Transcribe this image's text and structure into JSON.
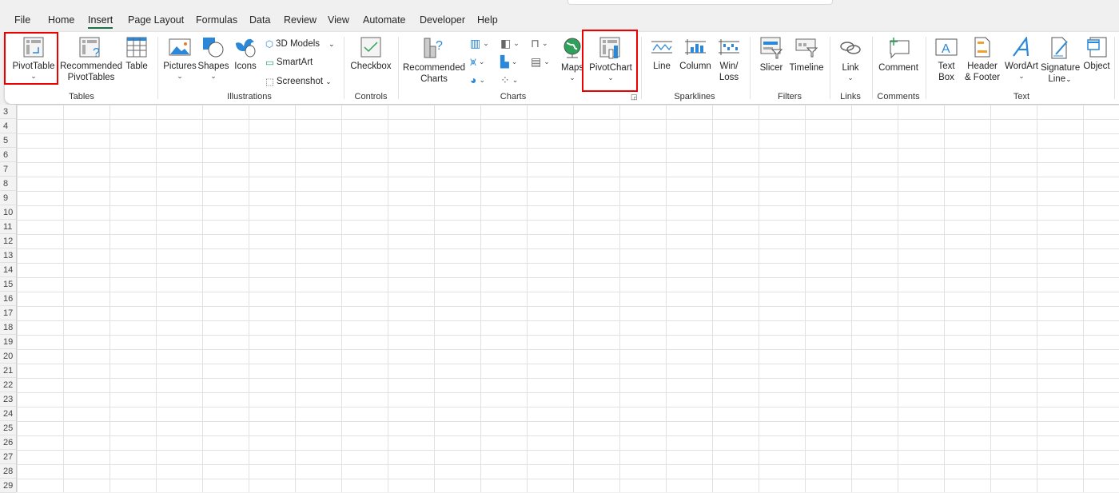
{
  "tabs": [
    "File",
    "Home",
    "Insert",
    "Page Layout",
    "Formulas",
    "Data",
    "Review",
    "View",
    "Automate",
    "Developer",
    "Help"
  ],
  "active_tab": "Insert",
  "groups": {
    "tables": "Tables",
    "illustrations": "Illustrations",
    "controls": "Controls",
    "charts": "Charts",
    "sparklines": "Sparklines",
    "filters": "Filters",
    "links": "Links",
    "comments": "Comments",
    "text": "Text"
  },
  "buttons": {
    "pivottable": "PivotTable",
    "rec_pivot_1": "Recommended",
    "rec_pivot_2": "PivotTables",
    "table": "Table",
    "pictures": "Pictures",
    "shapes": "Shapes",
    "icons": "Icons",
    "models3d": "3D Models",
    "smartart": "SmartArt",
    "screenshot": "Screenshot",
    "checkbox": "Checkbox",
    "rec_charts_1": "Recommended",
    "rec_charts_2": "Charts",
    "maps": "Maps",
    "pivotchart": "PivotChart",
    "line": "Line",
    "column": "Column",
    "winloss_1": "Win/",
    "winloss_2": "Loss",
    "slicer": "Slicer",
    "timeline": "Timeline",
    "link": "Link",
    "comment": "Comment",
    "textbox_1": "Text",
    "textbox_2": "Box",
    "header_1": "Header",
    "header_2": "& Footer",
    "wordart": "WordArt",
    "signature_1": "Signature",
    "signature_2": "Line",
    "object": "Object"
  },
  "highlighted": [
    "PivotTable",
    "PivotChart"
  ],
  "highlight_color": "#e00000",
  "accent_color": "#1e7145",
  "rows": [
    "3",
    "4",
    "5",
    "6",
    "7",
    "8",
    "9",
    "10",
    "11",
    "12",
    "13",
    "14",
    "15",
    "16",
    "17",
    "18",
    "19",
    "20",
    "21",
    "22",
    "23",
    "24",
    "25",
    "26",
    "27",
    "28",
    "29"
  ]
}
